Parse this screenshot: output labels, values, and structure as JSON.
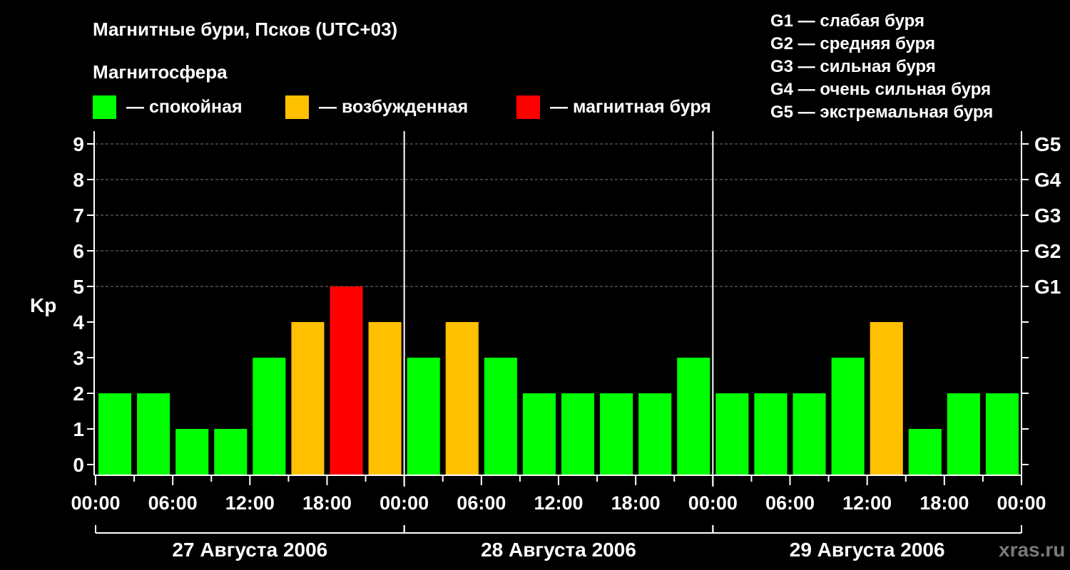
{
  "title": "Магнитные бури, Псков (UTC+03)",
  "magnetosphere_label": "Магнитосфера",
  "legend": [
    {
      "key": "calm",
      "label": "— спокойная",
      "color": "#00ff00"
    },
    {
      "key": "disturbed",
      "label": "— возбужденная",
      "color": "#ffc000"
    },
    {
      "key": "storm",
      "label": "— магнитная буря",
      "color": "#ff0000"
    }
  ],
  "g_legend": [
    "G1 — слабая буря",
    "G2 — средняя буря",
    "G3 — сильная буря",
    "G4 — очень сильная буря",
    "G5 — экстремальная буря"
  ],
  "watermark": "xras.ru",
  "chart_data": {
    "type": "bar",
    "ylabel": "Kp",
    "ylim": [
      0,
      9
    ],
    "y_ticks": [
      "0",
      "1",
      "2",
      "3",
      "4",
      "5",
      "6",
      "7",
      "8",
      "9"
    ],
    "right_ticks": [
      {
        "kp": 5,
        "label": "G1"
      },
      {
        "kp": 6,
        "label": "G2"
      },
      {
        "kp": 7,
        "label": "G3"
      },
      {
        "kp": 8,
        "label": "G4"
      },
      {
        "kp": 9,
        "label": "G5"
      }
    ],
    "grid": "dashed horizontal at Kp 5–9",
    "x_tick_labels": [
      "00:00",
      "06:00",
      "12:00",
      "18:00",
      "00:00",
      "06:00",
      "12:00",
      "18:00",
      "00:00",
      "06:00",
      "12:00",
      "18:00",
      "00:00"
    ],
    "days": [
      "27 Августа 2006",
      "28 Августа 2006",
      "29 Августа 2006"
    ],
    "bars_per_day": 8,
    "hours_per_bar": 3,
    "values": [
      2,
      2,
      1,
      1,
      3,
      4,
      5,
      4,
      3,
      4,
      3,
      2,
      2,
      2,
      2,
      3,
      2,
      2,
      2,
      3,
      4,
      1,
      2,
      2
    ],
    "colors": [
      "calm",
      "calm",
      "calm",
      "calm",
      "calm",
      "disturbed",
      "storm",
      "disturbed",
      "calm",
      "disturbed",
      "calm",
      "calm",
      "calm",
      "calm",
      "calm",
      "calm",
      "calm",
      "calm",
      "calm",
      "calm",
      "disturbed",
      "calm",
      "calm",
      "calm"
    ]
  }
}
